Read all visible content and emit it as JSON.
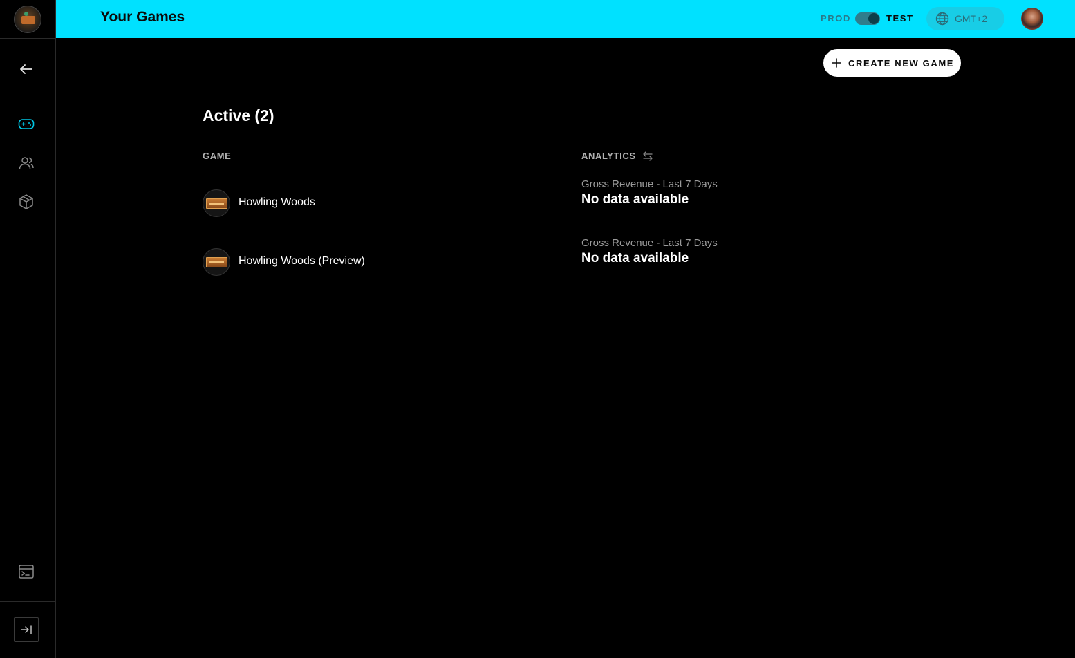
{
  "header": {
    "title": "Your Games",
    "env_left": "PROD",
    "env_right": "TEST",
    "env_selected": "TEST",
    "timezone": "GMT+2",
    "accent_color": "#00e1ff"
  },
  "sidebar": {
    "items": [
      {
        "icon": "arrow-left-icon"
      },
      {
        "icon": "gamepad-icon",
        "active": true
      },
      {
        "icon": "users-icon"
      },
      {
        "icon": "cube-icon"
      },
      {
        "icon": "terminal-icon"
      }
    ],
    "collapse_icon": "collapse-right-icon"
  },
  "actions": {
    "create_label": "CREATE NEW GAME"
  },
  "games_section": {
    "title": "Active (2)",
    "col_game": "GAME",
    "col_analytics": "ANALYTICS",
    "games": [
      {
        "name": "Howling Woods",
        "metric_label": "Gross Revenue - Last 7 Days",
        "metric_value": "No data available"
      },
      {
        "name": "Howling Woods (Preview)",
        "metric_label": "Gross Revenue - Last 7 Days",
        "metric_value": "No data available"
      }
    ]
  }
}
